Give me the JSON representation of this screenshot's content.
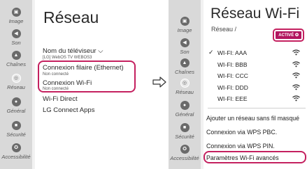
{
  "left_screen": {
    "sidebar": [
      {
        "label": "Image",
        "icon": "image-icon",
        "glyph": "▣"
      },
      {
        "label": "Son",
        "icon": "sound-icon",
        "glyph": "◀"
      },
      {
        "label": "Chaînes",
        "icon": "channels-icon",
        "glyph": "▲"
      },
      {
        "label": "Réseau",
        "icon": "network-icon",
        "glyph": "◎",
        "active": true
      },
      {
        "label": "Général",
        "icon": "general-icon",
        "glyph": "●"
      },
      {
        "label": "Sécurité",
        "icon": "lock-icon",
        "glyph": "■"
      },
      {
        "label": "Accessibilité",
        "icon": "accessibility-icon",
        "glyph": "✪"
      }
    ],
    "title": "Réseau",
    "menu": [
      {
        "label": "Nom du téléviseur ⌵",
        "sub": "[LG] WebOS TV WEBOS3"
      },
      {
        "label": "Connexion filaire (Ethernet)",
        "sub": "Non connecté"
      },
      {
        "label": "Connexion Wi-Fi",
        "sub": "Non connecté"
      },
      {
        "label": "Wi-Fi Direct",
        "sub": ""
      },
      {
        "label": "LG Connect Apps",
        "sub": ""
      }
    ]
  },
  "right_screen": {
    "sidebar": [
      {
        "label": "Image",
        "icon": "image-icon",
        "glyph": "▣"
      },
      {
        "label": "Son",
        "icon": "sound-icon",
        "glyph": "◀"
      },
      {
        "label": "Chaînes",
        "icon": "channels-icon",
        "glyph": "▲"
      },
      {
        "label": "Réseau",
        "icon": "network-icon",
        "glyph": "◎",
        "active": true
      },
      {
        "label": "Général",
        "icon": "general-icon",
        "glyph": "●"
      },
      {
        "label": "Sécurité",
        "icon": "lock-icon",
        "glyph": "■"
      },
      {
        "label": "Accessibilité",
        "icon": "accessibility-icon",
        "glyph": "✪"
      }
    ],
    "title": "Réseau Wi-Fi",
    "subtitle": "Réseau /",
    "active_badge": "ACTIVÉ ✪",
    "check_mark": "✓",
    "networks": [
      {
        "label": "WI-FI: AAA",
        "checked": true
      },
      {
        "label": "WI-FI: BBB",
        "checked": false
      },
      {
        "label": "WI-FI: CCC",
        "checked": false
      },
      {
        "label": "WI-FI: DDD",
        "checked": false
      },
      {
        "label": "WI-FI: EEE",
        "checked": false
      }
    ],
    "actions": [
      "Ajouter un réseau sans fil masqué",
      "Connexion via WPS PBC.",
      "Connexion via WPS PIN.",
      "Paramètres Wi-Fi avancés"
    ]
  },
  "colors": {
    "accent": "#c4205f",
    "panel": "#ffffff",
    "sidebar": "#d9d9d9"
  }
}
